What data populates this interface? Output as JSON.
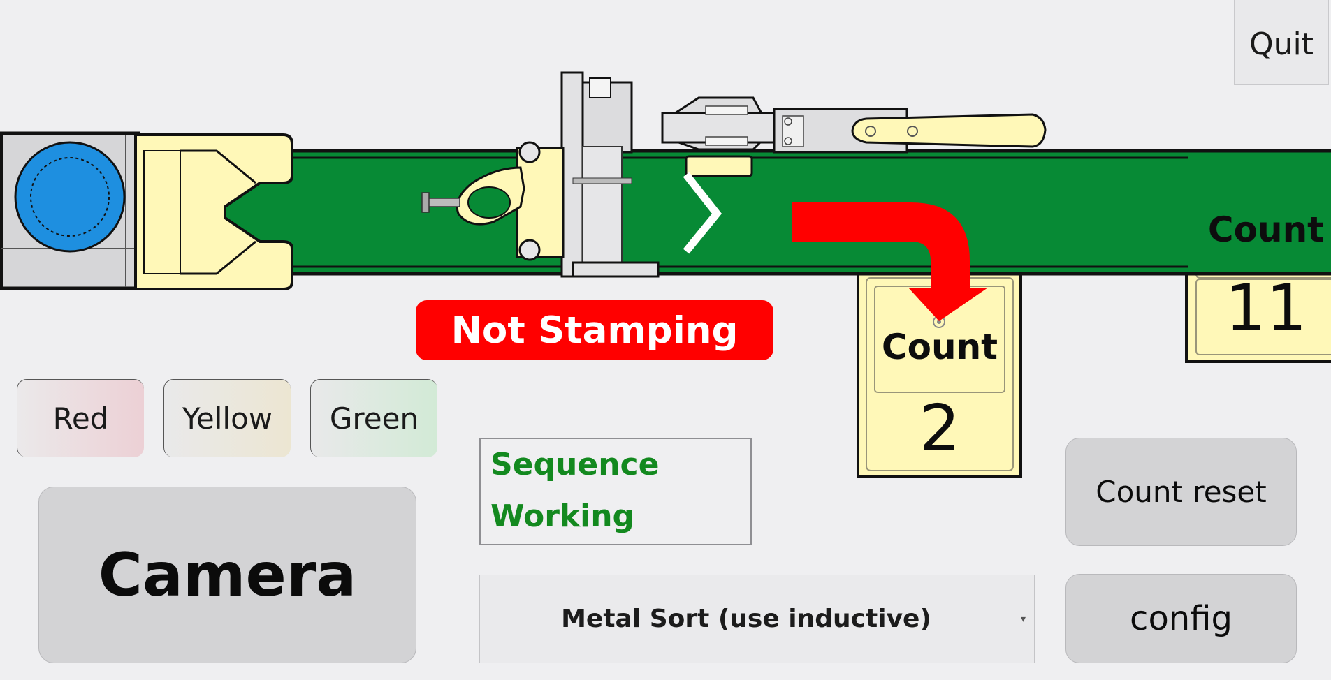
{
  "window": {
    "quit_label": "Quit"
  },
  "conveyor": {
    "stamp_status": "Not Stamping",
    "bin_side": {
      "label": "Count",
      "value": "2"
    },
    "bin_end": {
      "label": "Count",
      "value": "11"
    }
  },
  "color_buttons": {
    "red": "Red",
    "yellow": "Yellow",
    "green": "Green"
  },
  "camera_label": "Camera",
  "status": {
    "line1": "Sequence",
    "line2": "Working",
    "color": "#13891f"
  },
  "mode": {
    "selected": "Metal Sort (use inductive)"
  },
  "count_reset_label": "Count reset",
  "config_label": "config",
  "colors": {
    "belt": "#078a35",
    "bin_fill": "#fff8b8",
    "stop_red": "#ff0000",
    "feeder_blue": "#1e8fe0"
  }
}
